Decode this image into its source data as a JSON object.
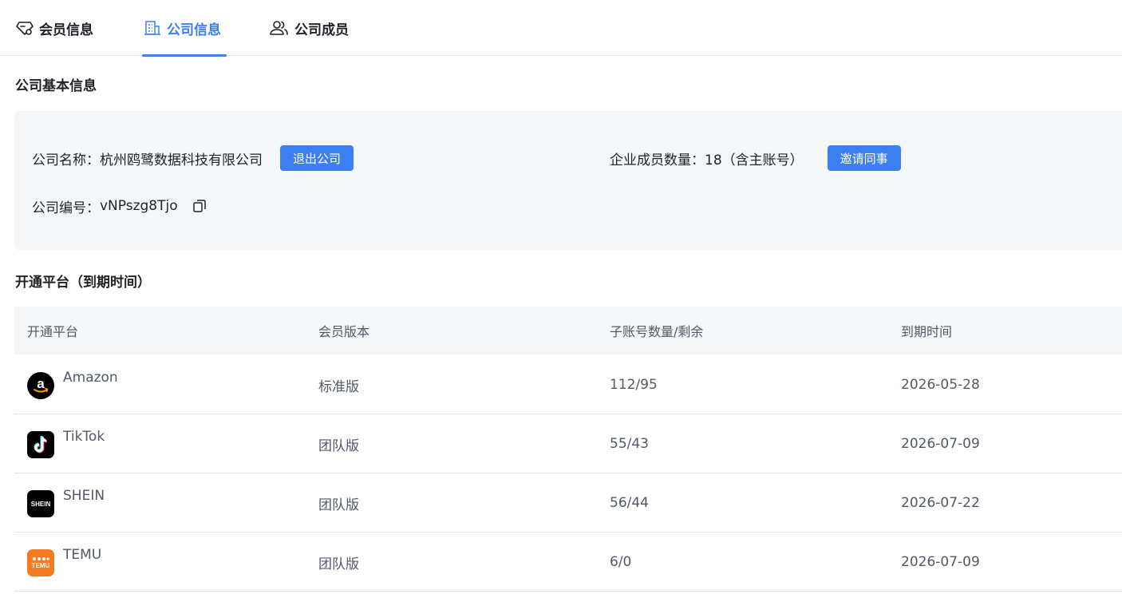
{
  "tabs": [
    {
      "label": "会员信息",
      "icon": "diamond-icon",
      "active": false
    },
    {
      "label": "公司信息",
      "icon": "building-icon",
      "active": true
    },
    {
      "label": "公司成员",
      "icon": "users-icon",
      "active": false
    }
  ],
  "basic_info": {
    "title": "公司基本信息",
    "company_name_label": "公司名称：",
    "company_name": "杭州鸥鹭数据科技有限公司",
    "exit_button": "退出公司",
    "member_count_label": "企业成员数量：",
    "member_count": "18（含主账号）",
    "invite_button": "邀请同事",
    "company_id_label": "公司编号：",
    "company_id": "vNPszg8Tjo"
  },
  "platforms": {
    "title": "开通平台（到期时间）",
    "columns": [
      "开通平台",
      "会员版本",
      "子账号数量/剩余",
      "到期时间"
    ],
    "rows": [
      {
        "platform": "Amazon",
        "edition": "标准版",
        "accounts": "112/95",
        "expiry": "2026-05-28",
        "logo": "amazon-icon"
      },
      {
        "platform": "TikTok",
        "edition": "团队版",
        "accounts": "55/43",
        "expiry": "2026-07-09",
        "logo": "tiktok-icon"
      },
      {
        "platform": "SHEIN",
        "edition": "团队版",
        "accounts": "56/44",
        "expiry": "2026-07-22",
        "logo": "shein-icon"
      },
      {
        "platform": "TEMU",
        "edition": "团队版",
        "accounts": "6/0",
        "expiry": "2026-07-09",
        "logo": "temu-icon"
      }
    ]
  },
  "logo_text": {
    "shein": "SHEIN",
    "temu": "TEMU"
  },
  "colors": {
    "accent": "#3b7ff0",
    "temu": "#f57b20"
  }
}
